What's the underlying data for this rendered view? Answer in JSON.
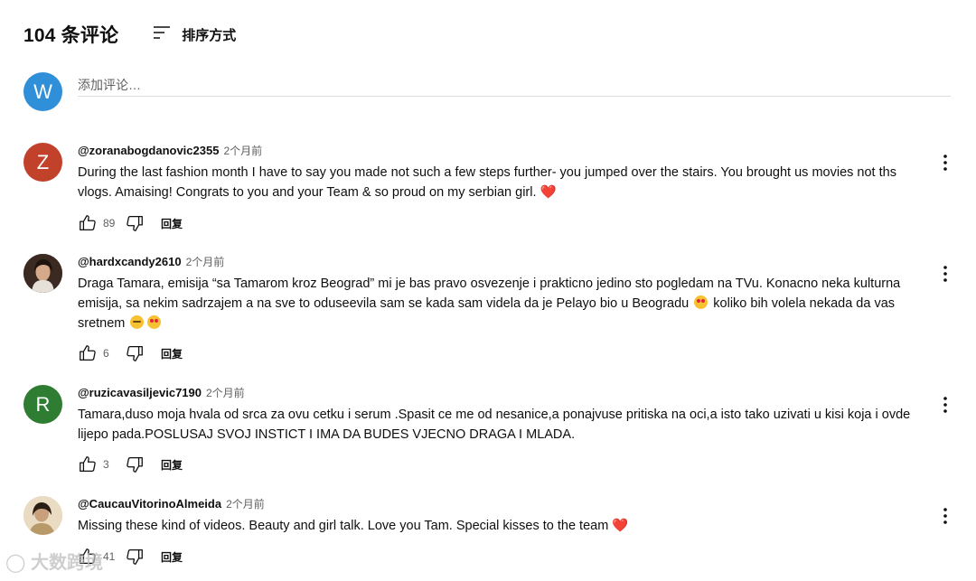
{
  "header": {
    "count_label": "104 条评论",
    "sort_label": "排序方式",
    "sort_icon": "sort-icon"
  },
  "add_comment": {
    "avatar_letter": "W",
    "avatar_color": "#2f8fd8",
    "placeholder": "添加评论…"
  },
  "comments": [
    {
      "author": "@zoranabogdanovic2355",
      "time": "2个月前",
      "avatar_letter": "Z",
      "avatar_color": "#c2412a",
      "text": "During the last fashion month I have to say you made not such a few steps further- you jumped over the stairs. You brought us movies not ths vlogs. Amaising! Congrats to you and your Team & so proud on my serbian girl.",
      "likes": "89",
      "reply_label": "回复"
    },
    {
      "author": "@hardxcandy2610",
      "time": "2个月前",
      "avatar_letter": "",
      "avatar_color": "#5a3b2c",
      "text_parts": [
        "Draga Tamara, emisija “sa Tamarom kroz Beograd” mi je bas pravo osvezenje i prakticno jedino sto pogledam na TVu. Konacno neka kulturna emisija, sa nekim sadrzajem a na sve to oduseevila sam se kada sam videla da je Pelayo bio u Beogradu ",
        " koliko bih volela nekada da vas sretnem "
      ],
      "likes": "6",
      "reply_label": "回复"
    },
    {
      "author": "@ruzicavasiljevic7190",
      "time": "2个月前",
      "avatar_letter": "R",
      "avatar_color": "#2e7d32",
      "text": "Tamara,duso moja hvala od srca za ovu cetku i serum .Spasit ce me od nesanice,a ponajvuse pritiska na oci,a isto tako uzivati u kisi koja i ovde lijepo pada.POSLUSAJ SVOJ INSTICT I IMA DA BUDES VJECNO DRAGA I MLADA.",
      "likes": "3",
      "reply_label": "回复"
    },
    {
      "author": "@CaucauVitorinoAlmeida",
      "time": "2个月前",
      "avatar_letter": "",
      "avatar_color": "#d9c7a6",
      "text": "Missing these kind of videos. Beauty and girl talk. Love you Tam. Special kisses to the team",
      "likes": "41",
      "reply_label": "回复"
    }
  ],
  "watermark": "大数跨境"
}
